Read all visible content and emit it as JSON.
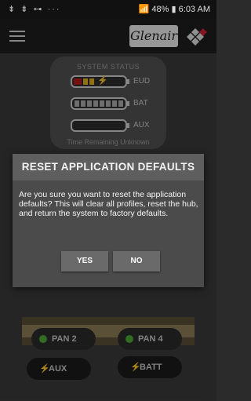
{
  "statusbar": {
    "left_icons": "⇟ ⇟ ⊶ ···",
    "battery": "48%",
    "time": "6:03 AM"
  },
  "app": {
    "logo_text": "Glenair"
  },
  "system_status": {
    "title": "SYSTEM STATUS",
    "rows": [
      {
        "label": "EUD",
        "fill": 0.5
      },
      {
        "label": "BAT",
        "fill": 1.0
      },
      {
        "label": "AUX",
        "fill": 0
      }
    ],
    "time_remaining": "Time Remaining Unknown"
  },
  "dialog": {
    "title": "RESET APPLICATION DEFAULTS",
    "message": "Are you sure you want to reset the application defaults? This will clear all profiles, reset the hub, and return the system to factory defaults.",
    "yes_label": "YES",
    "no_label": "NO"
  },
  "ports": [
    {
      "label": "PAN 2"
    },
    {
      "label": "PAN 4"
    },
    {
      "label": "AUX"
    },
    {
      "label": "BATT"
    }
  ],
  "colors": {
    "accent_green": "#4aa832",
    "charge_red": "#b31b1b",
    "charge_yellow": "#e0b020"
  }
}
